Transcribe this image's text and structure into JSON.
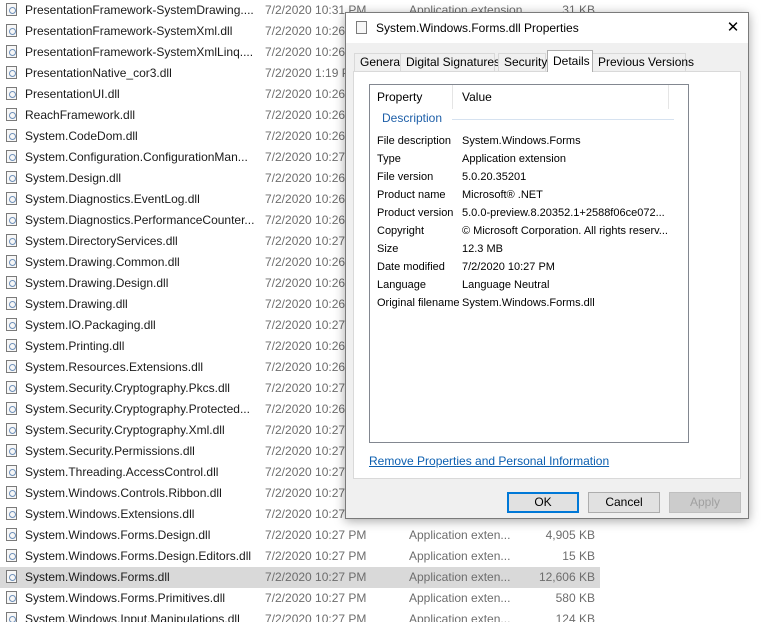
{
  "files": [
    {
      "name": "PresentationFramework-SystemDrawing....",
      "date": "7/2/2020 10:31 PM",
      "type": "Application extension",
      "size": "31 KB"
    },
    {
      "name": "PresentationFramework-SystemXml.dll",
      "date": "7/2/2020 10:26",
      "type": "",
      "size": ""
    },
    {
      "name": "PresentationFramework-SystemXmlLinq....",
      "date": "7/2/2020 10:26",
      "type": "",
      "size": ""
    },
    {
      "name": "PresentationNative_cor3.dll",
      "date": "7/2/2020 1:19 P",
      "type": "",
      "size": ""
    },
    {
      "name": "PresentationUI.dll",
      "date": "7/2/2020 10:26",
      "type": "",
      "size": ""
    },
    {
      "name": "ReachFramework.dll",
      "date": "7/2/2020 10:26",
      "type": "",
      "size": ""
    },
    {
      "name": "System.CodeDom.dll",
      "date": "7/2/2020 10:26",
      "type": "",
      "size": ""
    },
    {
      "name": "System.Configuration.ConfigurationMan...",
      "date": "7/2/2020 10:27",
      "type": "",
      "size": ""
    },
    {
      "name": "System.Design.dll",
      "date": "7/2/2020 10:26",
      "type": "",
      "size": ""
    },
    {
      "name": "System.Diagnostics.EventLog.dll",
      "date": "7/2/2020 10:26",
      "type": "",
      "size": ""
    },
    {
      "name": "System.Diagnostics.PerformanceCounter...",
      "date": "7/2/2020 10:26",
      "type": "",
      "size": ""
    },
    {
      "name": "System.DirectoryServices.dll",
      "date": "7/2/2020 10:27",
      "type": "",
      "size": ""
    },
    {
      "name": "System.Drawing.Common.dll",
      "date": "7/2/2020 10:26",
      "type": "",
      "size": ""
    },
    {
      "name": "System.Drawing.Design.dll",
      "date": "7/2/2020 10:26",
      "type": "",
      "size": ""
    },
    {
      "name": "System.Drawing.dll",
      "date": "7/2/2020 10:26",
      "type": "",
      "size": ""
    },
    {
      "name": "System.IO.Packaging.dll",
      "date": "7/2/2020 10:27",
      "type": "",
      "size": ""
    },
    {
      "name": "System.Printing.dll",
      "date": "7/2/2020 10:26",
      "type": "",
      "size": ""
    },
    {
      "name": "System.Resources.Extensions.dll",
      "date": "7/2/2020 10:26",
      "type": "",
      "size": ""
    },
    {
      "name": "System.Security.Cryptography.Pkcs.dll",
      "date": "7/2/2020 10:27",
      "type": "",
      "size": ""
    },
    {
      "name": "System.Security.Cryptography.Protected...",
      "date": "7/2/2020 10:26",
      "type": "",
      "size": ""
    },
    {
      "name": "System.Security.Cryptography.Xml.dll",
      "date": "7/2/2020 10:27",
      "type": "",
      "size": ""
    },
    {
      "name": "System.Security.Permissions.dll",
      "date": "7/2/2020 10:27",
      "type": "",
      "size": ""
    },
    {
      "name": "System.Threading.AccessControl.dll",
      "date": "7/2/2020 10:27",
      "type": "",
      "size": ""
    },
    {
      "name": "System.Windows.Controls.Ribbon.dll",
      "date": "7/2/2020 10:27",
      "type": "",
      "size": ""
    },
    {
      "name": "System.Windows.Extensions.dll",
      "date": "7/2/2020 10:27",
      "type": "",
      "size": ""
    },
    {
      "name": "System.Windows.Forms.Design.dll",
      "date": "7/2/2020 10:27 PM",
      "type": "Application exten...",
      "size": "4,905 KB"
    },
    {
      "name": "System.Windows.Forms.Design.Editors.dll",
      "date": "7/2/2020 10:27 PM",
      "type": "Application exten...",
      "size": "15 KB"
    },
    {
      "name": "System.Windows.Forms.dll",
      "date": "7/2/2020 10:27 PM",
      "type": "Application exten...",
      "size": "12,606 KB"
    },
    {
      "name": "System.Windows.Forms.Primitives.dll",
      "date": "7/2/2020 10:27 PM",
      "type": "Application exten...",
      "size": "580 KB"
    },
    {
      "name": "System.Windows.Input.Manipulations.dll",
      "date": "7/2/2020 10:27 PM",
      "type": "Application exten...",
      "size": "124 KB"
    }
  ],
  "selected_index": 27,
  "dialog": {
    "title": "System.Windows.Forms.dll Properties",
    "close_glyph": "✕",
    "tabs": [
      "General",
      "Digital Signatures",
      "Security",
      "Details",
      "Previous Versions"
    ],
    "active_tab": "Details",
    "header": {
      "property": "Property",
      "value": "Value"
    },
    "group": "Description",
    "rows": [
      {
        "key": "File description",
        "value": "System.Windows.Forms"
      },
      {
        "key": "Type",
        "value": "Application extension"
      },
      {
        "key": "File version",
        "value": "5.0.20.35201"
      },
      {
        "key": "Product name",
        "value": "Microsoft® .NET"
      },
      {
        "key": "Product version",
        "value": "5.0.0-preview.8.20352.1+2588f06ce072..."
      },
      {
        "key": "Copyright",
        "value": "© Microsoft Corporation. All rights reserv..."
      },
      {
        "key": "Size",
        "value": "12.3 MB"
      },
      {
        "key": "Date modified",
        "value": "7/2/2020 10:27 PM"
      },
      {
        "key": "Language",
        "value": "Language Neutral"
      },
      {
        "key": "Original filename",
        "value": "System.Windows.Forms.dll"
      }
    ],
    "remove_link": "Remove Properties and Personal Information",
    "buttons": {
      "ok": "OK",
      "cancel": "Cancel",
      "apply": "Apply"
    },
    "accent_color": "#0078d7"
  }
}
